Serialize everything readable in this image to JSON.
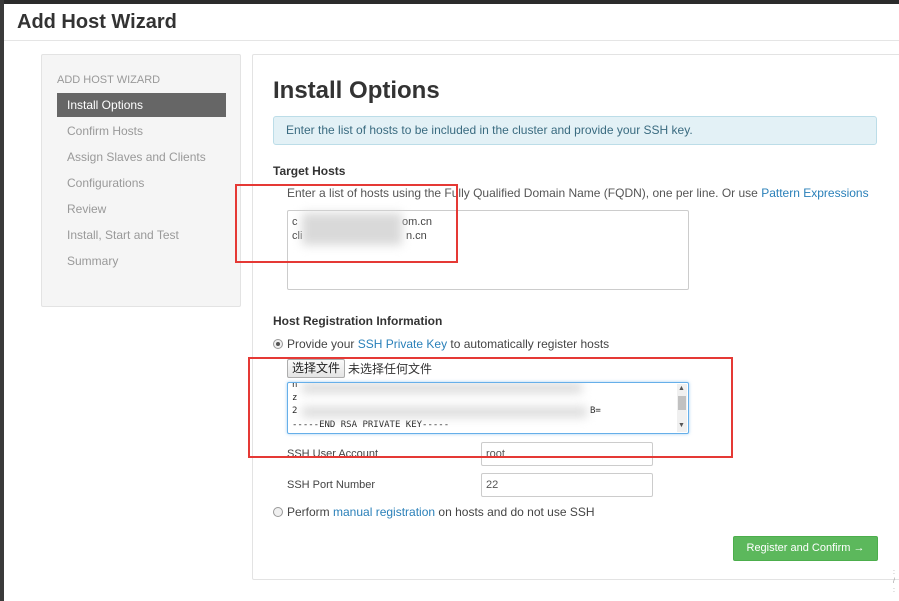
{
  "wizard": {
    "title": "Add Host Wizard"
  },
  "sidebar": {
    "header": "ADD HOST WIZARD",
    "items": [
      {
        "label": "Install Options",
        "active": true
      },
      {
        "label": "Confirm Hosts"
      },
      {
        "label": "Assign Slaves and Clients"
      },
      {
        "label": "Configurations"
      },
      {
        "label": "Review"
      },
      {
        "label": "Install, Start and Test"
      },
      {
        "label": "Summary"
      }
    ]
  },
  "main": {
    "title": "Install Options",
    "info_text": "Enter the list of hosts to be included in the cluster and provide your SSH key.",
    "target_hosts": {
      "heading": "Target Hosts",
      "hint_prefix": "Enter a list of hosts using the Fully Qualified Domain Name (FQDN), one per line. Or use ",
      "hint_link": "Pattern Expressions",
      "host_lines": [
        "c",
        "om.cn",
        "cli",
        "n.cn"
      ]
    },
    "registration": {
      "heading": "Host Registration Information",
      "option_ssh_prefix": "Provide your ",
      "option_ssh_link": "SSH Private Key",
      "option_ssh_suffix": " to automatically register hosts",
      "file_button": "选择文件",
      "file_status": "未选择任何文件",
      "key_lines": [
        "n",
        "z",
        "2",
        "B=",
        "-----END RSA PRIVATE KEY-----"
      ],
      "ssh_user_label": "SSH User Account",
      "ssh_user_value": "root",
      "ssh_port_label": "SSH Port Number",
      "ssh_port_value": "22",
      "option_manual_prefix": "Perform ",
      "option_manual_link": "manual registration",
      "option_manual_suffix": " on hosts and do not use SSH"
    },
    "register_button": "Register and Confirm →"
  },
  "colors": {
    "annotation": "#e53935",
    "link": "#2a80b9",
    "primary": "#5cb85c",
    "sidebar_active": "#666666",
    "info_bg": "#e3f1f6"
  }
}
